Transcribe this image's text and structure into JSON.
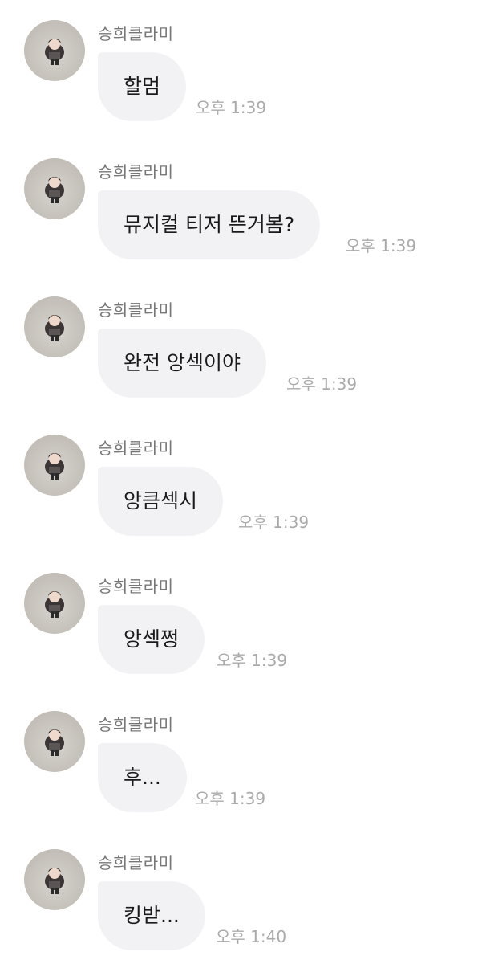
{
  "sender_name": "승희클라미",
  "messages": [
    {
      "text": "할멈",
      "time": "오후 1:39"
    },
    {
      "text": "뮤지컬 티저 뜬거봄?",
      "time": "오후 1:39"
    },
    {
      "text": "완전 앙섹이야",
      "time": "오후 1:39"
    },
    {
      "text": "앙큼섹시",
      "time": "오후 1:39"
    },
    {
      "text": "앙섹쩡",
      "time": "오후 1:39"
    },
    {
      "text": "후...",
      "time": "오후 1:39"
    },
    {
      "text": "킹받...",
      "time": "오후 1:40"
    }
  ]
}
